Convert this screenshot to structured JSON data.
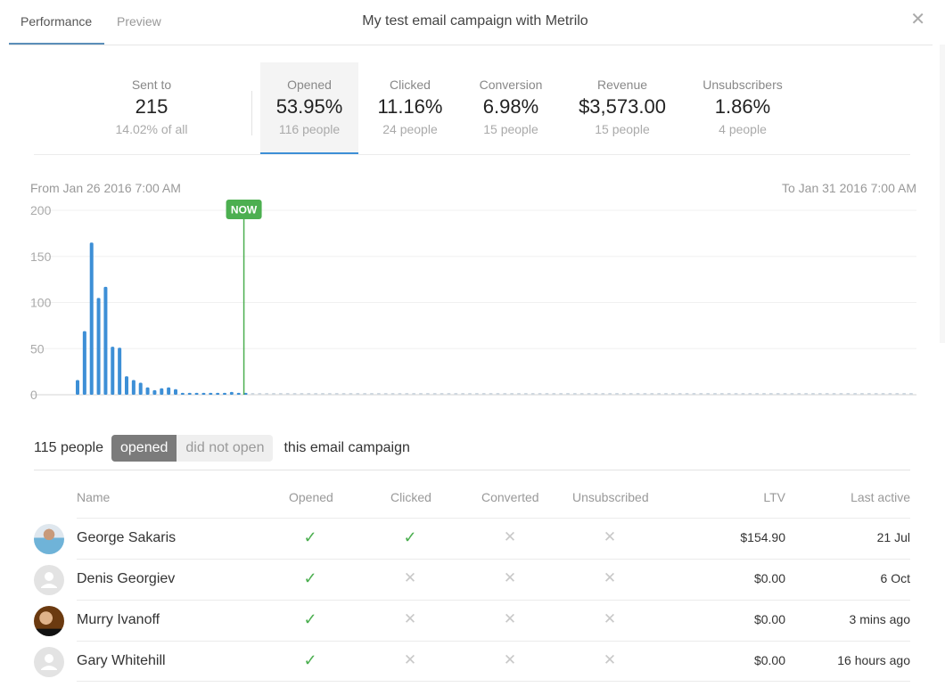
{
  "header": {
    "tabs": [
      {
        "label": "Performance",
        "active": true
      },
      {
        "label": "Preview",
        "active": false
      }
    ],
    "title": "My test email campaign with Metrilo",
    "close_icon": "close-icon"
  },
  "stats": [
    {
      "label": "Sent to",
      "value": "215",
      "sub": "14.02% of all",
      "active": false
    },
    {
      "label": "Opened",
      "value": "53.95%",
      "sub": "116 people",
      "active": true
    },
    {
      "label": "Clicked",
      "value": "11.16%",
      "sub": "24 people",
      "active": false
    },
    {
      "label": "Conversion",
      "value": "6.98%",
      "sub": "15 people",
      "active": false
    },
    {
      "label": "Revenue",
      "value": "$3,573.00",
      "sub": "15 people",
      "active": false
    },
    {
      "label": "Unsubscribers",
      "value": "1.86%",
      "sub": "4 people",
      "active": false
    }
  ],
  "range": {
    "from": "From Jan 26 2016 7:00 AM",
    "to": "To Jan 31 2016 7:00 AM"
  },
  "chart_data": {
    "type": "bar",
    "title": "",
    "xlabel": "",
    "ylabel": "",
    "ylim": [
      0,
      200
    ],
    "yticks": [
      0,
      50,
      100,
      150,
      200
    ],
    "grid": true,
    "now_label": "NOW",
    "now_index": 24,
    "colors": {
      "bar": "#3d8fd6",
      "future": "#cfd8e0",
      "now": "#4caf50"
    },
    "values": [
      16,
      69,
      165,
      105,
      117,
      52,
      51,
      20,
      16,
      13,
      8,
      5,
      7,
      8,
      6,
      2,
      2,
      2,
      2,
      2,
      2,
      2,
      3,
      2,
      2
    ],
    "future_count": 95
  },
  "filter": {
    "count_text": "115 people",
    "options": [
      {
        "label": "opened",
        "active": true
      },
      {
        "label": "did not open",
        "active": false
      }
    ],
    "suffix": "this email campaign"
  },
  "table": {
    "columns": [
      "Name",
      "Opened",
      "Clicked",
      "Converted",
      "Unsubscribed",
      "LTV",
      "Last active"
    ],
    "rows": [
      {
        "name": "George Sakaris",
        "avatar": "photo",
        "opened": true,
        "clicked": true,
        "converted": false,
        "unsubscribed": false,
        "ltv": "$154.90",
        "last_active": "21 Jul"
      },
      {
        "name": "Denis Georgiev",
        "avatar": "placeholder",
        "opened": true,
        "clicked": false,
        "converted": false,
        "unsubscribed": false,
        "ltv": "$0.00",
        "last_active": "6 Oct"
      },
      {
        "name": "Murry Ivanoff",
        "avatar": "photo",
        "opened": true,
        "clicked": false,
        "converted": false,
        "unsubscribed": false,
        "ltv": "$0.00",
        "last_active": "3 mins ago"
      },
      {
        "name": "Gary Whitehill",
        "avatar": "placeholder",
        "opened": true,
        "clicked": false,
        "converted": false,
        "unsubscribed": false,
        "ltv": "$0.00",
        "last_active": "16 hours ago"
      }
    ],
    "icons": {
      "yes": "✓",
      "no": "✕"
    }
  }
}
